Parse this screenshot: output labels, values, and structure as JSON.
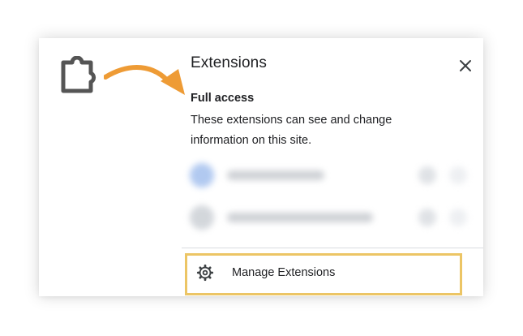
{
  "popup": {
    "title": "Extensions",
    "close_label": "×",
    "section_heading": "Full access",
    "section_description": "These extensions can see and change information on this site.",
    "manage_label": "Manage Extensions"
  },
  "icons": {
    "extension": "puzzle-piece-icon",
    "pointer": "curved-arrow-icon",
    "close": "close-icon",
    "manage": "gear-icon"
  },
  "colors": {
    "arrow": "#ee9b35",
    "highlight_border": "#ecc565",
    "text": "#202124",
    "puzzle": "#555555"
  }
}
